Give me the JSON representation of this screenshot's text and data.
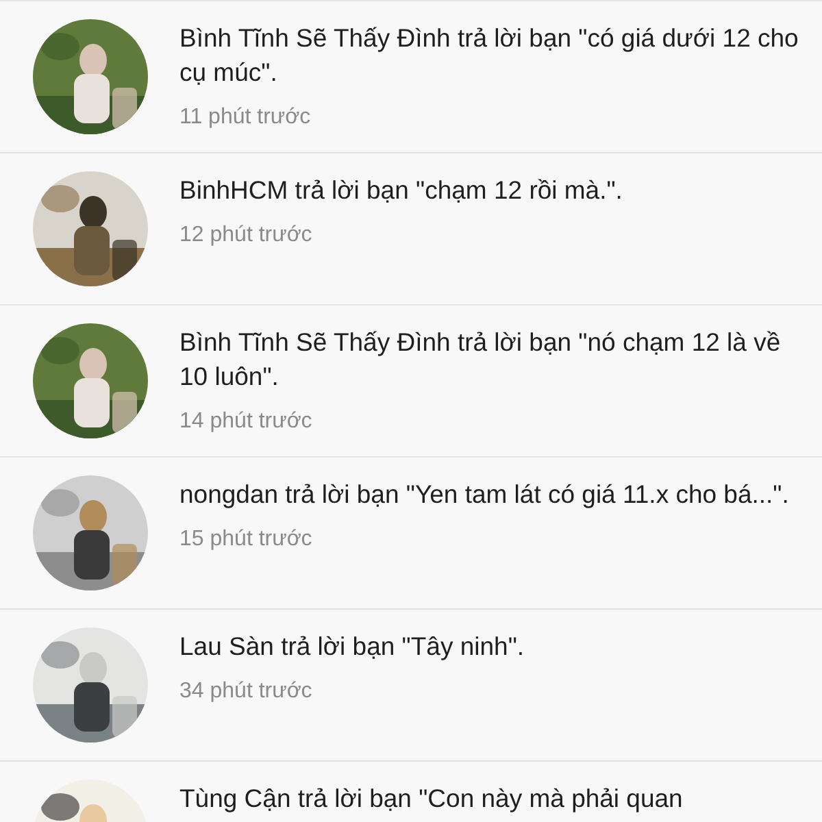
{
  "notifications": [
    {
      "message": "Bình Tĩnh Sẽ Thấy Đình trả lời bạn \"có giá dưới 12 cho cụ múc\".",
      "time": "11 phút trước"
    },
    {
      "message": "BinhHCM trả lời bạn \"chạm 12 rồi mà.\".",
      "time": "12 phút trước"
    },
    {
      "message": "Bình Tĩnh Sẽ Thấy Đình trả lời bạn \"nó chạm 12 là về 10 luôn\".",
      "time": "14 phút trước"
    },
    {
      "message": "nongdan trả lời bạn \"Yen tam lát có giá 11.x cho bá...\".",
      "time": "15 phút trước"
    },
    {
      "message": "Lau Sàn trả lời bạn \"Tây ninh\".",
      "time": "34 phút trước"
    },
    {
      "message": "Tùng Cận trả lời bạn \"Con này mà phải quan"
    }
  ]
}
